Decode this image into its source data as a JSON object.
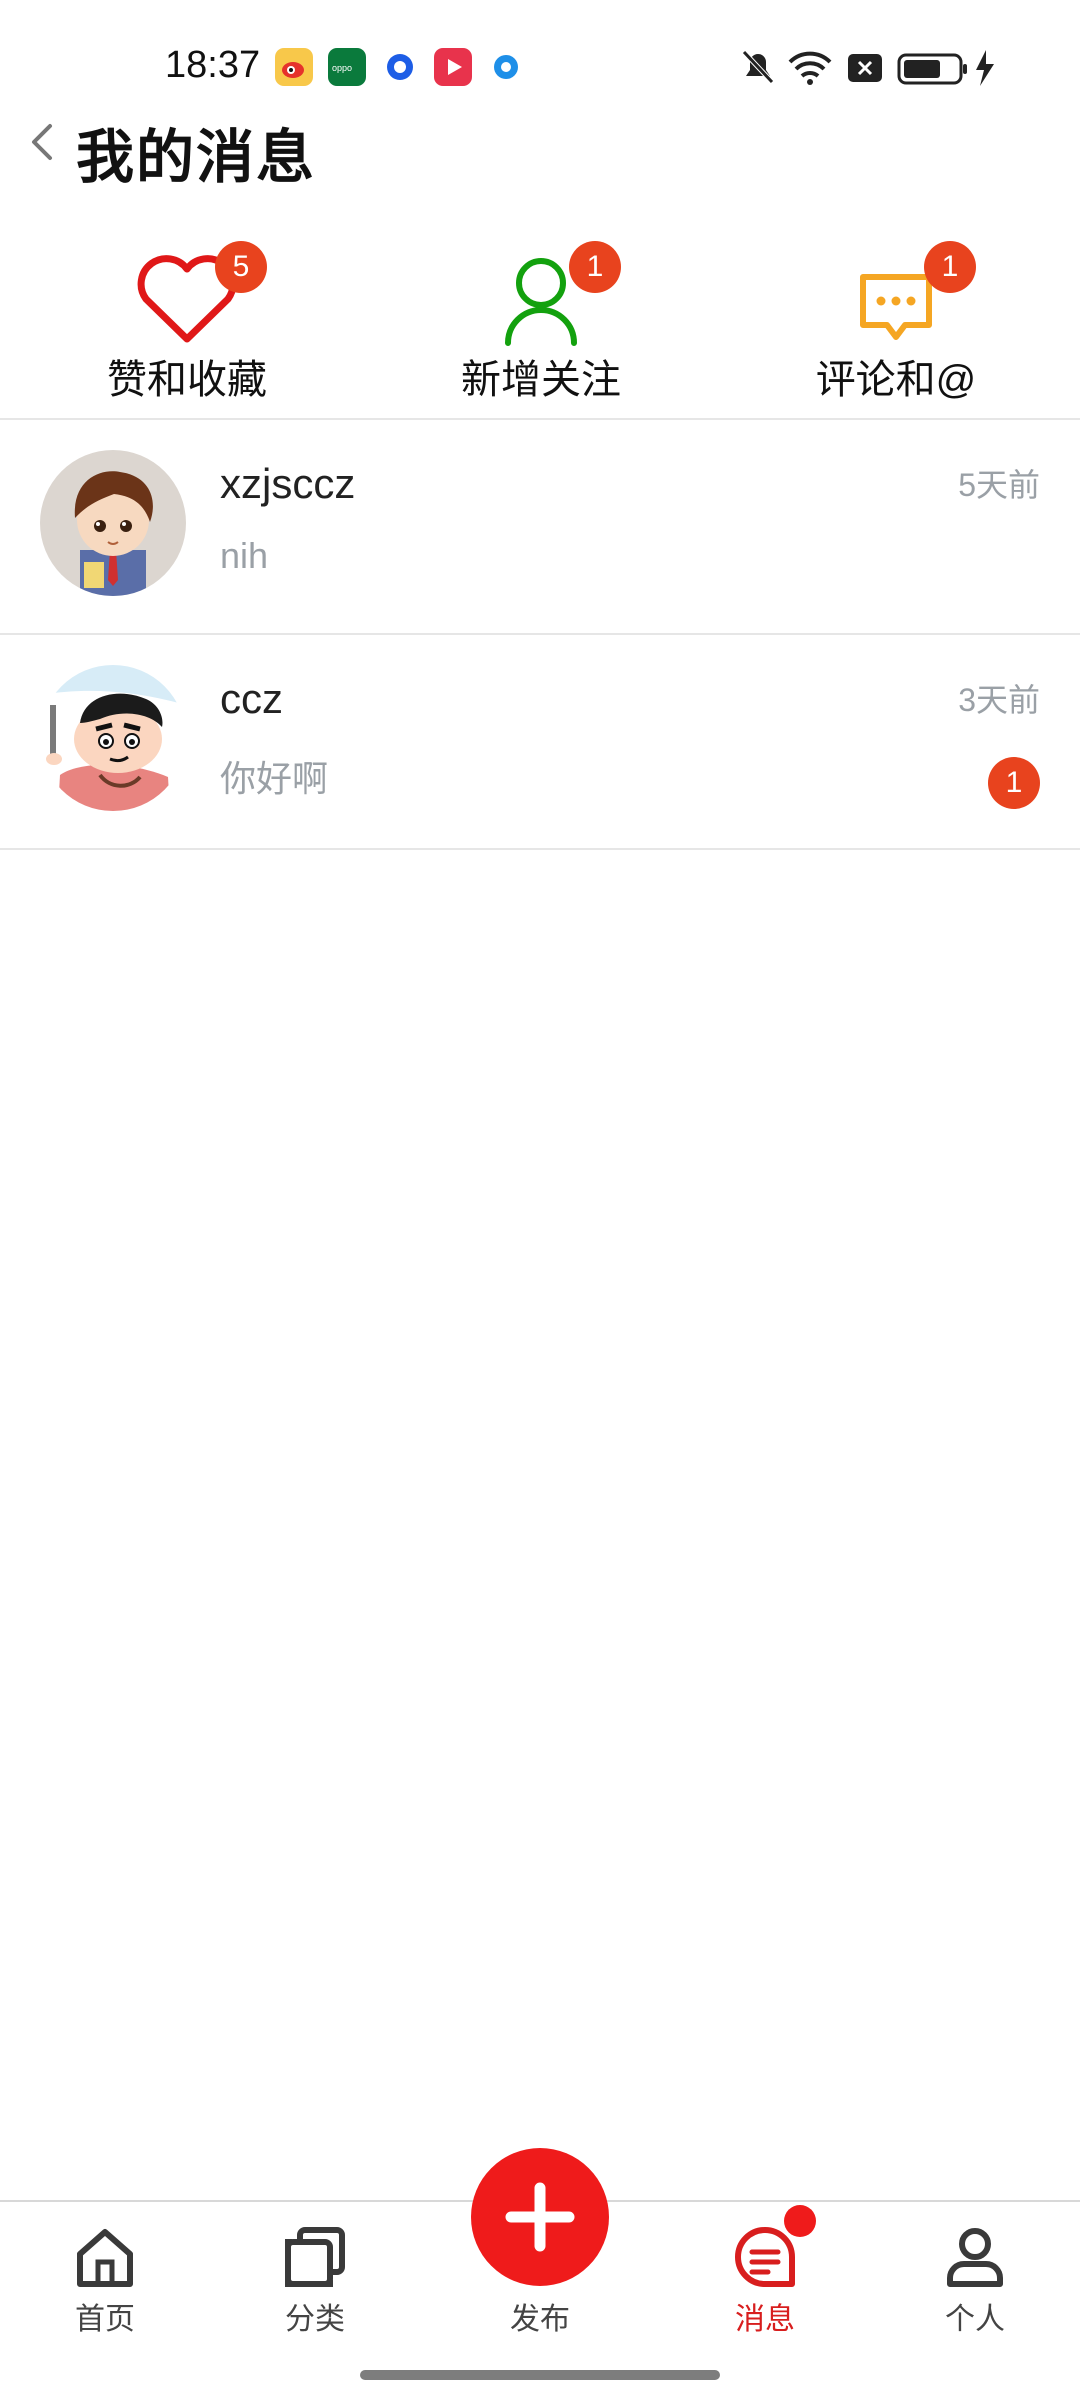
{
  "status_bar": {
    "time": "18:37",
    "app_icons": [
      "weibo-icon",
      "oppo-icon",
      "browser-icon",
      "video-icon",
      "toggle-icon"
    ],
    "right_icons": [
      "mute-bell-icon",
      "wifi-icon",
      "close-box-icon",
      "battery-icon",
      "charging-icon"
    ]
  },
  "header": {
    "back_icon": "chevron-left-icon",
    "title": "我的消息"
  },
  "categories": [
    {
      "label": "赞和收藏",
      "badge": "5",
      "icon": "heart-icon",
      "color": "#e01818"
    },
    {
      "label": "新增关注",
      "badge": "1",
      "icon": "user-icon",
      "color": "#13a10e"
    },
    {
      "label": "评论和@",
      "badge": "1",
      "icon": "comment-icon",
      "color": "#f5a623"
    }
  ],
  "messages": [
    {
      "name": "xzjsccz",
      "text": "nih",
      "time": "5天前",
      "badge": ""
    },
    {
      "name": "ccz",
      "text": "你好啊",
      "time": "3天前",
      "badge": "1"
    }
  ],
  "bottom_nav": {
    "items": [
      {
        "label": "首页",
        "icon": "home-icon",
        "active": false
      },
      {
        "label": "分类",
        "icon": "category-icon",
        "active": false
      },
      {
        "label": "发布",
        "icon": "plus-icon",
        "active": false
      },
      {
        "label": "消息",
        "icon": "message-icon",
        "active": true
      },
      {
        "label": "个人",
        "icon": "profile-icon",
        "active": false
      }
    ]
  },
  "colors": {
    "accent": "#ef1b1b",
    "badge": "#e8431e",
    "muted_text": "#9aa0a6"
  }
}
